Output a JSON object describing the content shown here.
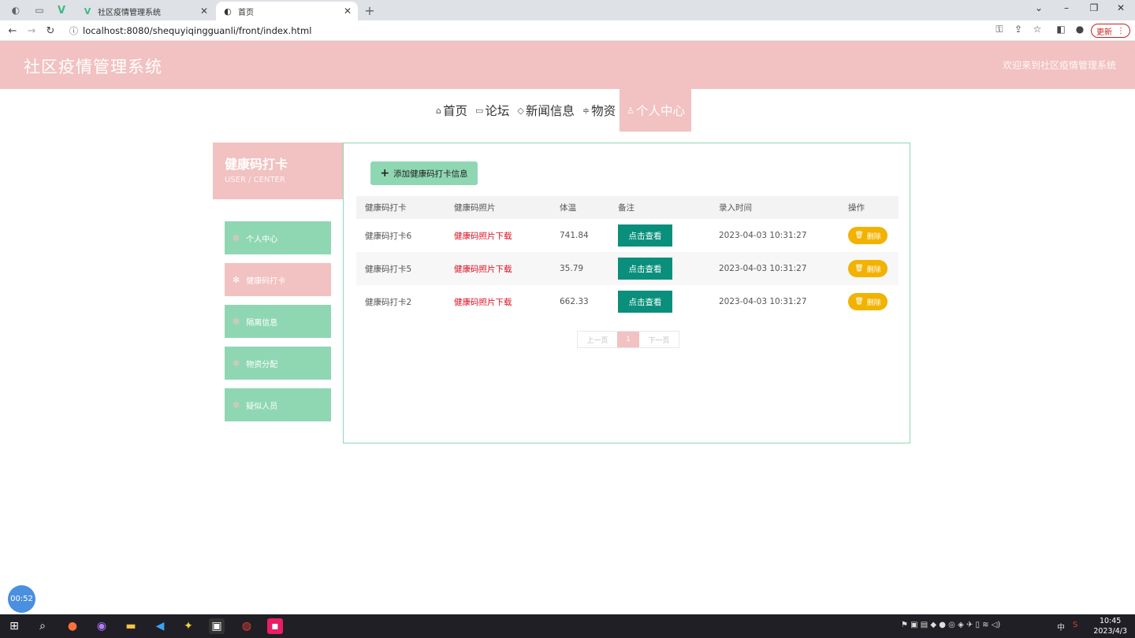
{
  "browser": {
    "tabs": [
      {
        "title": "社区疫情管理系统",
        "active": false
      },
      {
        "title": "首页",
        "active": true
      }
    ],
    "url": "localhost:8080/shequyiqingguanli/front/index.html",
    "update_label": "更新"
  },
  "header": {
    "title": "社区疫情管理系统",
    "welcome": "欢迎来到社区疫情管理系统"
  },
  "nav": [
    {
      "label": "首页",
      "icon": "home-icon"
    },
    {
      "label": "论坛",
      "icon": "book-icon"
    },
    {
      "label": "新闻信息",
      "icon": "tag-icon"
    },
    {
      "label": "物资",
      "icon": "filter-icon"
    },
    {
      "label": "个人中心",
      "icon": "user-icon",
      "active": true
    }
  ],
  "sidebar": {
    "title": "健康码打卡",
    "subtitle": "USER / CENTER",
    "items": [
      {
        "label": "个人中心",
        "active": false
      },
      {
        "label": "健康码打卡",
        "active": true
      },
      {
        "label": "隔离信息",
        "active": false
      },
      {
        "label": "物资分配",
        "active": false
      },
      {
        "label": "疑似人员",
        "active": false
      }
    ]
  },
  "main": {
    "add_label": "添加健康码打卡信息",
    "columns": [
      "健康码打卡",
      "健康码照片",
      "体温",
      "备注",
      "录入时间",
      "操作"
    ],
    "rows": [
      {
        "name": "健康码打卡6",
        "photo": "健康码照片下载",
        "temp": "741.84",
        "note": "点击查看",
        "time": "2023-04-03 10:31:27",
        "op": "删除"
      },
      {
        "name": "健康码打卡5",
        "photo": "健康码照片下载",
        "temp": "35.79",
        "note": "点击查看",
        "time": "2023-04-03 10:31:27",
        "op": "删除"
      },
      {
        "name": "健康码打卡2",
        "photo": "健康码照片下载",
        "temp": "662.33",
        "note": "点击查看",
        "time": "2023-04-03 10:31:27",
        "op": "删除"
      }
    ],
    "pager": {
      "prev": "上一页",
      "current": "1",
      "next": "下一页"
    }
  },
  "recorder": {
    "time": "00:52"
  },
  "taskbar": {
    "time": "10:45",
    "date": "2023/4/3",
    "ime": "中"
  },
  "colors": {
    "pink": "#f2c1c1",
    "green": "#8fd7b3",
    "teal": "#0a8f7c",
    "yellow": "#f2b200"
  }
}
